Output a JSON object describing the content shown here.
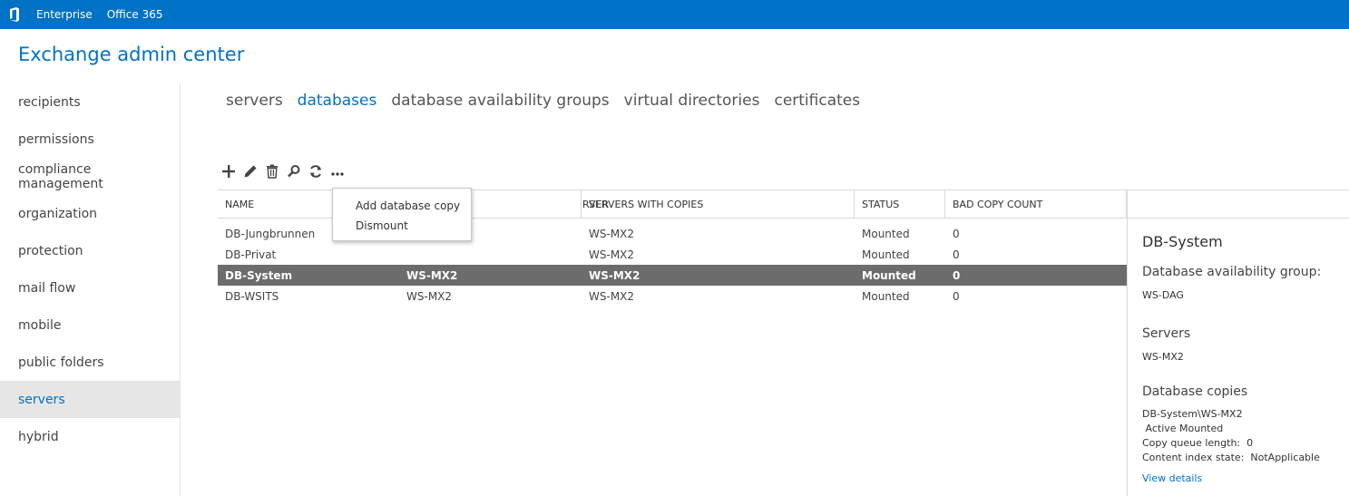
{
  "topbar": {
    "links": [
      "Enterprise",
      "Office 365"
    ],
    "logo_icon": "office-logo-icon",
    "color": "#0072c6"
  },
  "app_title": "Exchange admin center",
  "leftnav": {
    "items": [
      "recipients",
      "permissions",
      "compliance management",
      "organization",
      "protection",
      "mail flow",
      "mobile",
      "public folders",
      "servers",
      "hybrid"
    ],
    "active": "servers"
  },
  "subtabs": {
    "items": [
      "servers",
      "databases",
      "database availability groups",
      "virtual directories",
      "certificates"
    ],
    "active": "databases"
  },
  "toolbar": {
    "icons": [
      "add-icon",
      "edit-icon",
      "delete-icon",
      "search-icon",
      "refresh-icon",
      "more-icon"
    ]
  },
  "menu": {
    "items": [
      "Add database copy",
      "Dismount"
    ]
  },
  "table": {
    "columns": [
      "NAME",
      "SERVER",
      "SERVERS WITH COPIES",
      "STATUS",
      "BAD COPY COUNT"
    ],
    "column_visible_text": [
      "NAME",
      "RVER",
      "SERVERS WITH COPIES",
      "STATUS",
      "BAD COPY COUNT"
    ],
    "rows": [
      {
        "name": "DB-Jungbrunnen",
        "server": "",
        "copies": "WS-MX2",
        "status": "Mounted",
        "bad": "0"
      },
      {
        "name": "DB-Privat",
        "server": "",
        "copies": "WS-MX2",
        "status": "Mounted",
        "bad": "0"
      },
      {
        "name": "DB-System",
        "server": "WS-MX2",
        "copies": "WS-MX2",
        "status": "Mounted",
        "bad": "0"
      },
      {
        "name": "DB-WSITS",
        "server": "WS-MX2",
        "copies": "WS-MX2",
        "status": "Mounted",
        "bad": "0"
      }
    ],
    "selected_row": 2
  },
  "details": {
    "title": "DB-System",
    "dag_label": "Database availability group:",
    "dag_value": "WS-DAG",
    "servers_label": "Servers",
    "servers_value": "WS-MX2",
    "copies_label": "Database copies",
    "copy_line1": "DB-System\\WS-MX2",
    "copy_line2": " Active Mounted",
    "copy_line3": "Copy queue length:  0",
    "copy_line4": "Content index state:  NotApplicable",
    "view_details": "View details"
  }
}
